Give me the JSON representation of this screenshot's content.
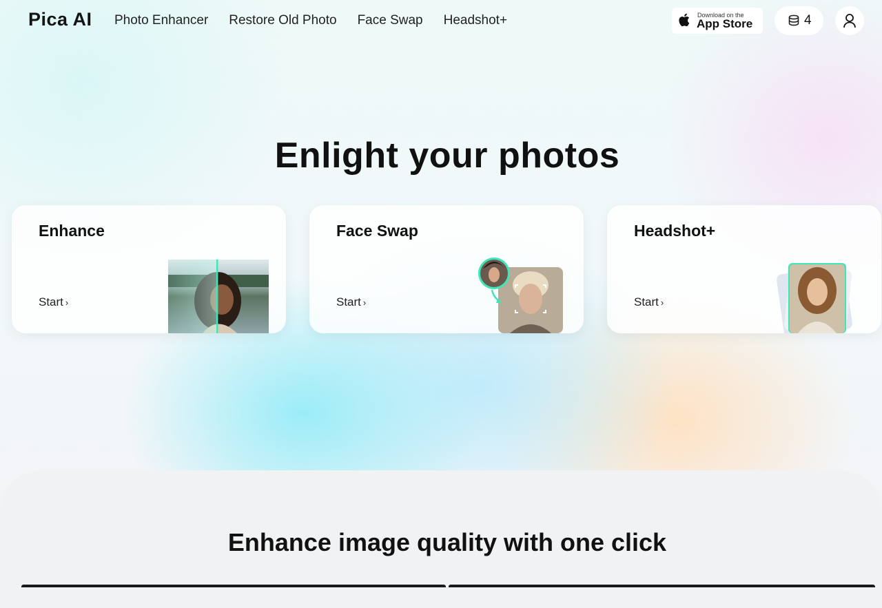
{
  "nav": {
    "logo": "Pica AI",
    "links": [
      "Photo Enhancer",
      "Restore Old Photo",
      "Face Swap",
      "Headshot+"
    ],
    "appstore_small": "Download on the",
    "appstore_big": "App Store",
    "credits": "4",
    "icons": [
      "apple-icon",
      "coin-stack-icon",
      "user-icon"
    ]
  },
  "hero": {
    "title": "Enlight your photos"
  },
  "cards": [
    {
      "title": "Enhance",
      "start": "Start"
    },
    {
      "title": "Face Swap",
      "start": "Start"
    },
    {
      "title": "Headshot+",
      "start": "Start"
    }
  ],
  "section2": {
    "title": "Enhance image quality with one click"
  },
  "colors": {
    "accent_green": "#3ee6b8",
    "text": "#111111"
  }
}
